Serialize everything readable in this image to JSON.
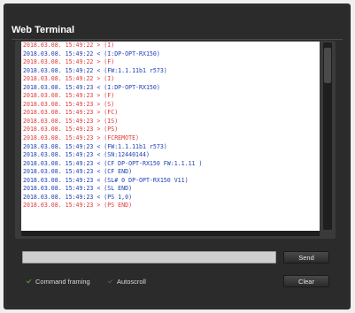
{
  "window": {
    "title": "Web Terminal"
  },
  "colors": {
    "sent": "#e03a3a",
    "received": "#1f3fb5"
  },
  "log": [
    {
      "text": "2018.03.08. 15:49:22 > (I)",
      "dir": "sent"
    },
    {
      "text": "2018.03.08. 15:49:22 < (I:DP-OPT-RX150)",
      "dir": "received"
    },
    {
      "text": "2018.03.08. 15:49:22 > (F)",
      "dir": "sent"
    },
    {
      "text": "2018.03.08. 15:49:22 < (FW:1.1.11b1 r573)",
      "dir": "received"
    },
    {
      "text": "2018.03.08. 15:49:22 > (I)",
      "dir": "sent"
    },
    {
      "text": "2018.03.08. 15:49:23 < (I:DP-OPT-RX150)",
      "dir": "received"
    },
    {
      "text": "2018.03.08. 15:49:23 > (F)",
      "dir": "sent"
    },
    {
      "text": "2018.03.08. 15:49:23 > (S)",
      "dir": "sent"
    },
    {
      "text": "2018.03.08. 15:49:23 > (FC)",
      "dir": "sent"
    },
    {
      "text": "2018.03.08. 15:49:23 > (IS)",
      "dir": "sent"
    },
    {
      "text": "2018.03.08. 15:49:23 > (PS)",
      "dir": "sent"
    },
    {
      "text": "2018.03.08. 15:49:23 > (FCREMOTE)",
      "dir": "sent"
    },
    {
      "text": "2018.03.08. 15:49:23 < (FW:1.1.11b1 r573)",
      "dir": "received"
    },
    {
      "text": "2018.03.08. 15:49:23 < (SN:12440144)",
      "dir": "received"
    },
    {
      "text": "2018.03.08. 15:49:23 < (CF DP-OPT-RX150 FW:1.1.11 )",
      "dir": "received"
    },
    {
      "text": "2018.03.08. 15:49:23 < (CF END)",
      "dir": "received"
    },
    {
      "text": "2018.03.08. 15:49:23 < (SL# 0 DP-OPT-RX150 V11)",
      "dir": "received"
    },
    {
      "text": "2018.03.08. 15:49:23 < (SL END)",
      "dir": "received"
    },
    {
      "text": "2018.03.08. 15:49:23 < (PS 1,0)",
      "dir": "received"
    },
    {
      "text": "2018.03.08. 15:49:23 > (PS END)",
      "dir": "sent"
    }
  ],
  "input": {
    "value": "",
    "placeholder": ""
  },
  "buttons": {
    "send": "Send",
    "clear": "Clear"
  },
  "options": {
    "framing": {
      "label": "Command framing",
      "checked": true
    },
    "autoscroll": {
      "label": "Autoscroll",
      "checked": false
    }
  }
}
